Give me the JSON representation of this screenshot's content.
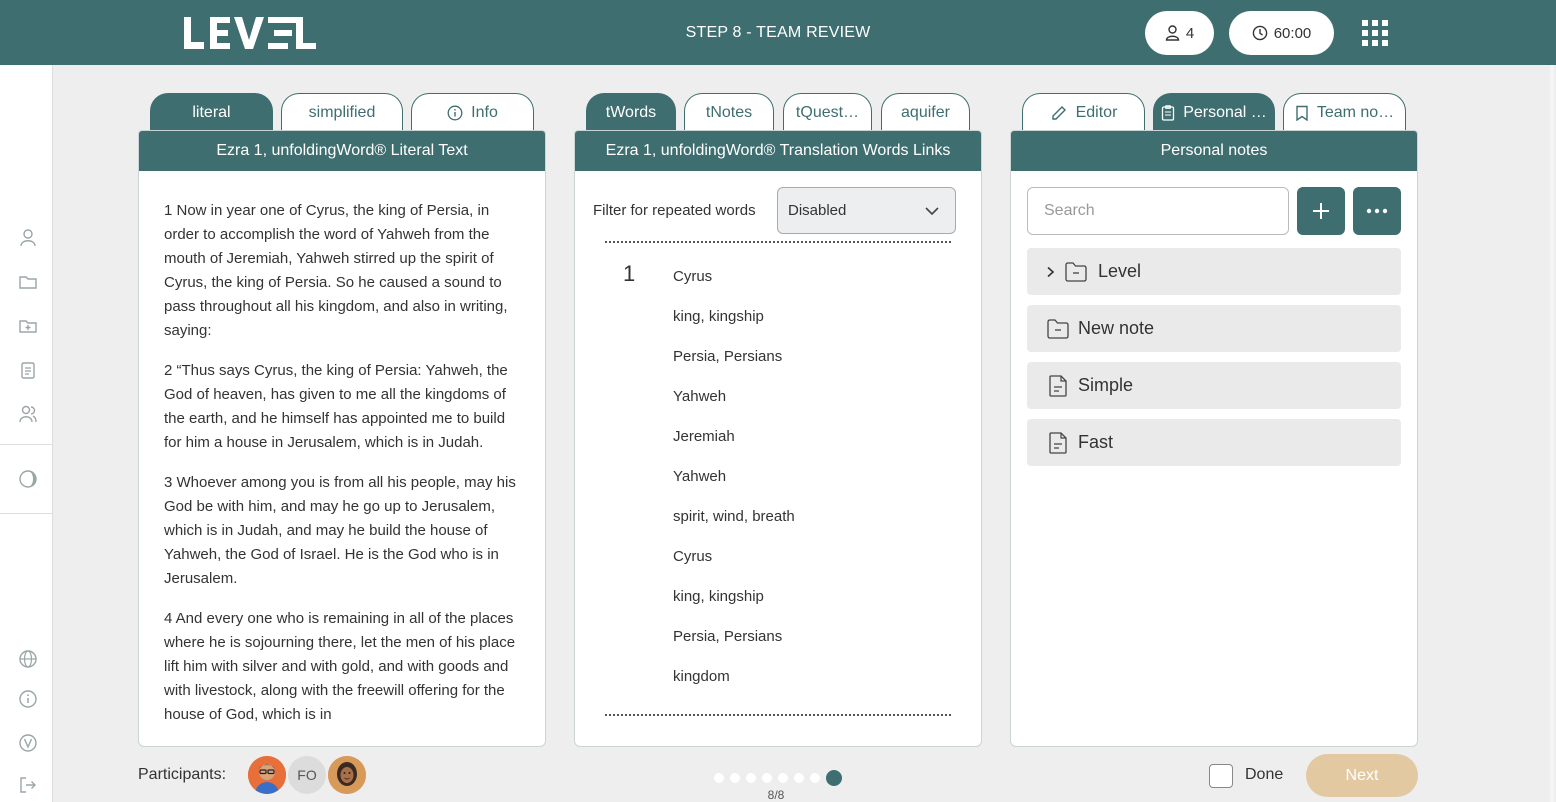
{
  "header": {
    "logo": "LEVEL",
    "step_title": "STEP 8 - TEAM REVIEW",
    "participants_count": "4",
    "timer": "60:00",
    "apps_icon": "grid-icon"
  },
  "sidebar": {
    "icons": [
      "user-icon",
      "folder-icon",
      "folder-plus-icon",
      "clipboard-icon",
      "users-icon",
      "theme-icon",
      "globe-icon",
      "info-icon",
      "version-icon",
      "logout-icon"
    ]
  },
  "panels": {
    "left": {
      "tabs": [
        {
          "label": "literal",
          "active": true
        },
        {
          "label": "simplified",
          "active": false
        },
        {
          "label": "Info",
          "active": false,
          "icon": "info-icon"
        }
      ],
      "title": "Ezra 1, unfoldingWord® Literal Text",
      "verses": [
        "1 Now in year one of Cyrus, the king of Persia, in order to accomplish the word of Yahweh from the mouth of Jeremiah, Yahweh stirred up the spirit of Cyrus, the king of Persia. So he caused a sound to pass throughout all his kingdom, and also in writing, saying:",
        "2 “Thus says Cyrus, the king of Persia: Yahweh, the God of heaven, has given to me all the kingdoms of the earth, and he himself has appointed me to build for him a house in Jerusalem, which is in Judah.",
        "3 Whoever among you is from all his people, may his God be with him, and may he go up to Jerusalem, which is in Judah, and may he build the house of Yahweh, the God of Israel. He is the God who is in Jerusalem.",
        "4 And every one who is remaining in all of the places where he is sojourning there, let the men of his place lift him with silver and with gold, and with goods and with livestock, along with the freewill offering for the house of God, which is in"
      ]
    },
    "middle": {
      "tabs": [
        {
          "label": "tWords",
          "active": true
        },
        {
          "label": "tNotes",
          "active": false
        },
        {
          "label": "tQuest…",
          "active": false
        },
        {
          "label": "aquifer",
          "active": false
        }
      ],
      "title": "Ezra 1, unfoldingWord® Translation Words Links",
      "filter_label": "Filter for repeated words",
      "filter_value": "Disabled",
      "verse_number": "1",
      "words": [
        "Cyrus",
        "king, kingship",
        "Persia, Persians",
        "Yahweh",
        "Jeremiah",
        "Yahweh",
        "spirit, wind, breath",
        "Cyrus",
        "king, kingship",
        "Persia, Persians",
        "kingdom"
      ]
    },
    "right": {
      "tabs": [
        {
          "label": "Editor",
          "active": false,
          "icon": "pencil-icon"
        },
        {
          "label": "Personal …",
          "active": true,
          "icon": "clipboard-icon"
        },
        {
          "label": "Team no…",
          "active": false,
          "icon": "bookmark-icon"
        }
      ],
      "title": "Personal notes",
      "search_placeholder": "Search",
      "notes": [
        {
          "label": "Level",
          "type": "folder",
          "expandable": true
        },
        {
          "label": "New note",
          "type": "folder",
          "expandable": false
        },
        {
          "label": "Simple",
          "type": "note",
          "expandable": false
        },
        {
          "label": "Fast",
          "type": "note",
          "expandable": false
        }
      ]
    }
  },
  "footer": {
    "participants_label": "Participants:",
    "participants": [
      {
        "type": "photo"
      },
      {
        "type": "initials",
        "text": "FO"
      },
      {
        "type": "photo"
      }
    ],
    "steps_total": 8,
    "step_current": 8,
    "page_count": "8/8",
    "done_label": "Done",
    "done_checked": false,
    "next_label": "Next"
  },
  "colors": {
    "primary": "#3f6e70",
    "next_button": "#e3c9a1",
    "background": "#eeeeee"
  }
}
